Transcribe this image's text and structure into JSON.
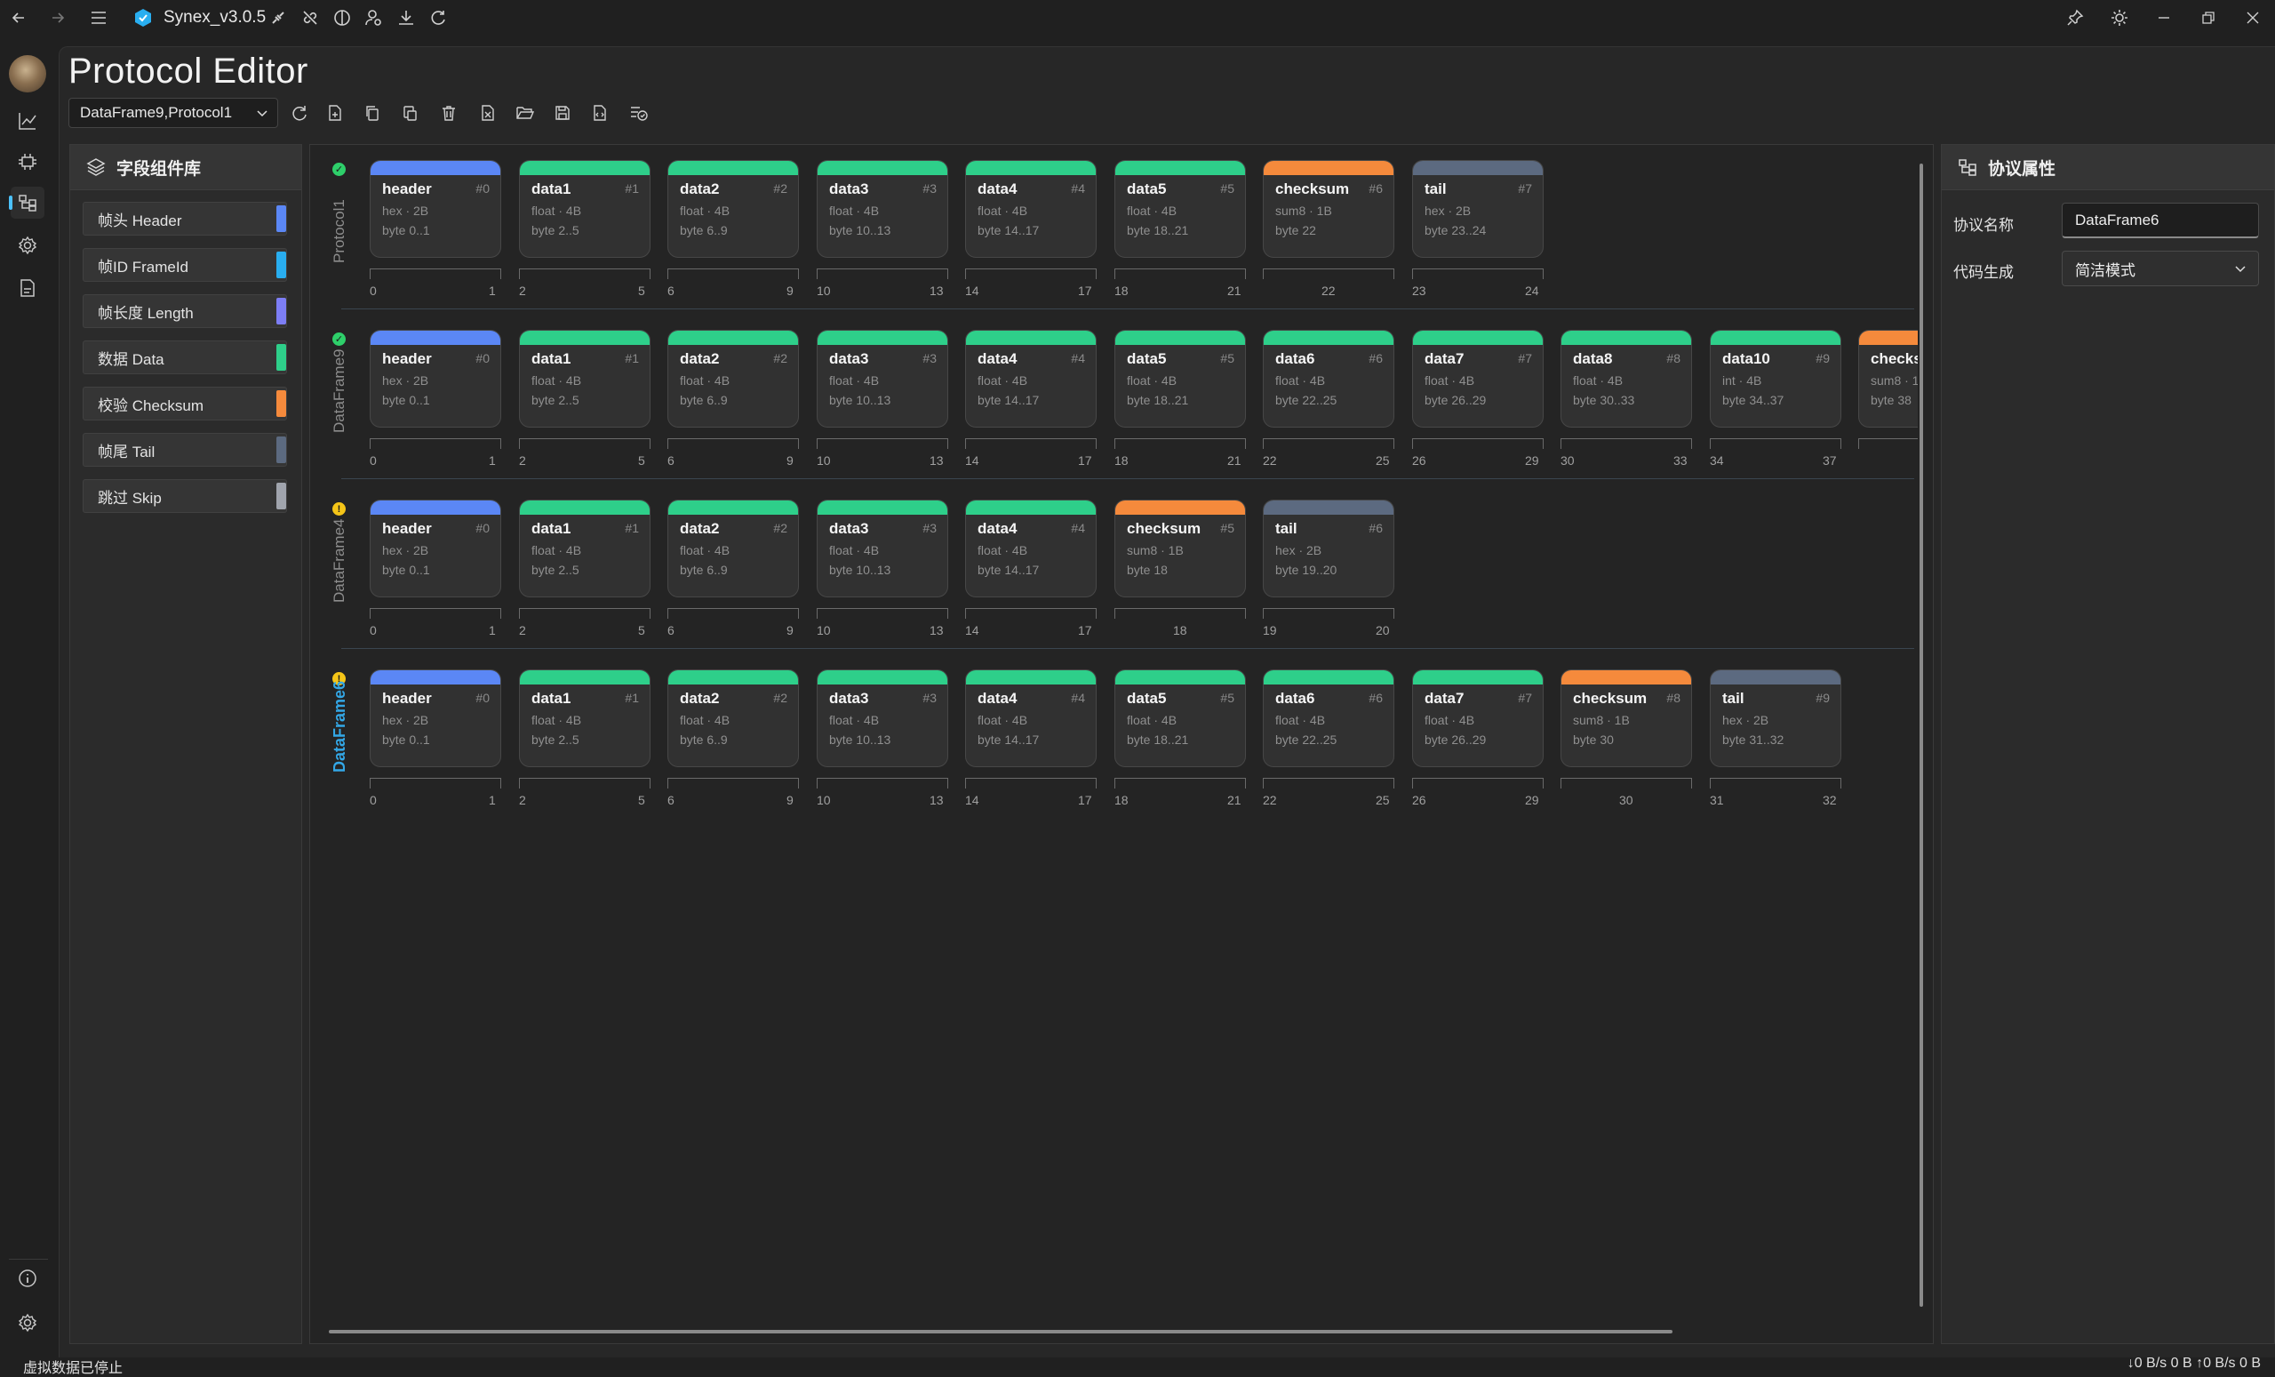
{
  "app": {
    "title": "Synex_v3.0.5",
    "accent": "#4cc2ff"
  },
  "page": {
    "title": "Protocol Editor"
  },
  "selector": {
    "value": "DataFrame9,Protocol1"
  },
  "library": {
    "title": "字段组件库",
    "items": [
      {
        "label": "帧头 Header",
        "color": "#5b87f5"
      },
      {
        "label": "帧ID FrameId",
        "color": "#29aef0"
      },
      {
        "label": "帧长度 Length",
        "color": "#7d7ef5"
      },
      {
        "label": "数据 Data",
        "color": "#2ecf8a"
      },
      {
        "label": "校验 Checksum",
        "color": "#f58a3c"
      },
      {
        "label": "帧尾 Tail",
        "color": "#5c6a80"
      },
      {
        "label": "跳过 Skip",
        "color": "#a0a4ad"
      }
    ]
  },
  "properties": {
    "title": "协议属性",
    "name_label": "协议名称",
    "name_value": "DataFrame6",
    "code_label": "代码生成",
    "code_value": "简洁模式"
  },
  "status": {
    "left": "虚拟数据已停止",
    "right": "↓0 B/s 0 B   ↑0 B/s 0 B"
  },
  "colors": {
    "header": "#5b87f5",
    "data": "#2ecf8a",
    "checksum": "#f58a3c",
    "tail": "#5c6a80",
    "ok": "#2ecf6a",
    "warn": "#f5c518",
    "selected": "#33a7e6"
  },
  "protocols": [
    {
      "name": "Protocol1",
      "status": "ok",
      "selected": false,
      "fields": [
        {
          "name": "header",
          "idx": "#0",
          "meta": "hex · 2B",
          "bytes": "byte 0..1",
          "kind": "header",
          "start": "0",
          "end": "1"
        },
        {
          "name": "data1",
          "idx": "#1",
          "meta": "float · 4B",
          "bytes": "byte 2..5",
          "kind": "data",
          "start": "2",
          "end": "5"
        },
        {
          "name": "data2",
          "idx": "#2",
          "meta": "float · 4B",
          "bytes": "byte 6..9",
          "kind": "data",
          "start": "6",
          "end": "9"
        },
        {
          "name": "data3",
          "idx": "#3",
          "meta": "float · 4B",
          "bytes": "byte 10..13",
          "kind": "data",
          "start": "10",
          "end": "13"
        },
        {
          "name": "data4",
          "idx": "#4",
          "meta": "float · 4B",
          "bytes": "byte 14..17",
          "kind": "data",
          "start": "14",
          "end": "17"
        },
        {
          "name": "data5",
          "idx": "#5",
          "meta": "float · 4B",
          "bytes": "byte 18..21",
          "kind": "data",
          "start": "18",
          "end": "21"
        },
        {
          "name": "checksum",
          "idx": "#6",
          "meta": "sum8 · 1B",
          "bytes": "byte 22",
          "kind": "checksum",
          "start": "22",
          "end": ""
        },
        {
          "name": "tail",
          "idx": "#7",
          "meta": "hex · 2B",
          "bytes": "byte 23..24",
          "kind": "tail",
          "start": "23",
          "end": "24"
        }
      ]
    },
    {
      "name": "DataFrame9",
      "status": "ok",
      "selected": false,
      "fields": [
        {
          "name": "header",
          "idx": "#0",
          "meta": "hex · 2B",
          "bytes": "byte 0..1",
          "kind": "header",
          "start": "0",
          "end": "1"
        },
        {
          "name": "data1",
          "idx": "#1",
          "meta": "float · 4B",
          "bytes": "byte 2..5",
          "kind": "data",
          "start": "2",
          "end": "5"
        },
        {
          "name": "data2",
          "idx": "#2",
          "meta": "float · 4B",
          "bytes": "byte 6..9",
          "kind": "data",
          "start": "6",
          "end": "9"
        },
        {
          "name": "data3",
          "idx": "#3",
          "meta": "float · 4B",
          "bytes": "byte 10..13",
          "kind": "data",
          "start": "10",
          "end": "13"
        },
        {
          "name": "data4",
          "idx": "#4",
          "meta": "float · 4B",
          "bytes": "byte 14..17",
          "kind": "data",
          "start": "14",
          "end": "17"
        },
        {
          "name": "data5",
          "idx": "#5",
          "meta": "float · 4B",
          "bytes": "byte 18..21",
          "kind": "data",
          "start": "18",
          "end": "21"
        },
        {
          "name": "data6",
          "idx": "#6",
          "meta": "float · 4B",
          "bytes": "byte 22..25",
          "kind": "data",
          "start": "22",
          "end": "25"
        },
        {
          "name": "data7",
          "idx": "#7",
          "meta": "float · 4B",
          "bytes": "byte 26..29",
          "kind": "data",
          "start": "26",
          "end": "29"
        },
        {
          "name": "data8",
          "idx": "#8",
          "meta": "float · 4B",
          "bytes": "byte 30..33",
          "kind": "data",
          "start": "30",
          "end": "33"
        },
        {
          "name": "data10",
          "idx": "#9",
          "meta": "int · 4B",
          "bytes": "byte 34..37",
          "kind": "data",
          "start": "34",
          "end": "37"
        },
        {
          "name": "checks",
          "idx": "",
          "meta": "sum8 · 1",
          "bytes": "byte 38",
          "kind": "checksum",
          "start": "",
          "end": ""
        }
      ]
    },
    {
      "name": "DataFrame4",
      "status": "warn",
      "selected": false,
      "fields": [
        {
          "name": "header",
          "idx": "#0",
          "meta": "hex · 2B",
          "bytes": "byte 0..1",
          "kind": "header",
          "start": "0",
          "end": "1"
        },
        {
          "name": "data1",
          "idx": "#1",
          "meta": "float · 4B",
          "bytes": "byte 2..5",
          "kind": "data",
          "start": "2",
          "end": "5"
        },
        {
          "name": "data2",
          "idx": "#2",
          "meta": "float · 4B",
          "bytes": "byte 6..9",
          "kind": "data",
          "start": "6",
          "end": "9"
        },
        {
          "name": "data3",
          "idx": "#3",
          "meta": "float · 4B",
          "bytes": "byte 10..13",
          "kind": "data",
          "start": "10",
          "end": "13"
        },
        {
          "name": "data4",
          "idx": "#4",
          "meta": "float · 4B",
          "bytes": "byte 14..17",
          "kind": "data",
          "start": "14",
          "end": "17"
        },
        {
          "name": "checksum",
          "idx": "#5",
          "meta": "sum8 · 1B",
          "bytes": "byte 18",
          "kind": "checksum",
          "start": "18",
          "end": ""
        },
        {
          "name": "tail",
          "idx": "#6",
          "meta": "hex · 2B",
          "bytes": "byte 19..20",
          "kind": "tail",
          "start": "19",
          "end": "20"
        }
      ]
    },
    {
      "name": "DataFrame6",
      "status": "warn",
      "selected": true,
      "fields": [
        {
          "name": "header",
          "idx": "#0",
          "meta": "hex · 2B",
          "bytes": "byte 0..1",
          "kind": "header",
          "start": "0",
          "end": "1"
        },
        {
          "name": "data1",
          "idx": "#1",
          "meta": "float · 4B",
          "bytes": "byte 2..5",
          "kind": "data",
          "start": "2",
          "end": "5"
        },
        {
          "name": "data2",
          "idx": "#2",
          "meta": "float · 4B",
          "bytes": "byte 6..9",
          "kind": "data",
          "start": "6",
          "end": "9"
        },
        {
          "name": "data3",
          "idx": "#3",
          "meta": "float · 4B",
          "bytes": "byte 10..13",
          "kind": "data",
          "start": "10",
          "end": "13"
        },
        {
          "name": "data4",
          "idx": "#4",
          "meta": "float · 4B",
          "bytes": "byte 14..17",
          "kind": "data",
          "start": "14",
          "end": "17"
        },
        {
          "name": "data5",
          "idx": "#5",
          "meta": "float · 4B",
          "bytes": "byte 18..21",
          "kind": "data",
          "start": "18",
          "end": "21"
        },
        {
          "name": "data6",
          "idx": "#6",
          "meta": "float · 4B",
          "bytes": "byte 22..25",
          "kind": "data",
          "start": "22",
          "end": "25"
        },
        {
          "name": "data7",
          "idx": "#7",
          "meta": "float · 4B",
          "bytes": "byte 26..29",
          "kind": "data",
          "start": "26",
          "end": "29"
        },
        {
          "name": "checksum",
          "idx": "#8",
          "meta": "sum8 · 1B",
          "bytes": "byte 30",
          "kind": "checksum",
          "start": "30",
          "end": ""
        },
        {
          "name": "tail",
          "idx": "#9",
          "meta": "hex · 2B",
          "bytes": "byte 31..32",
          "kind": "tail",
          "start": "31",
          "end": "32"
        }
      ]
    }
  ]
}
